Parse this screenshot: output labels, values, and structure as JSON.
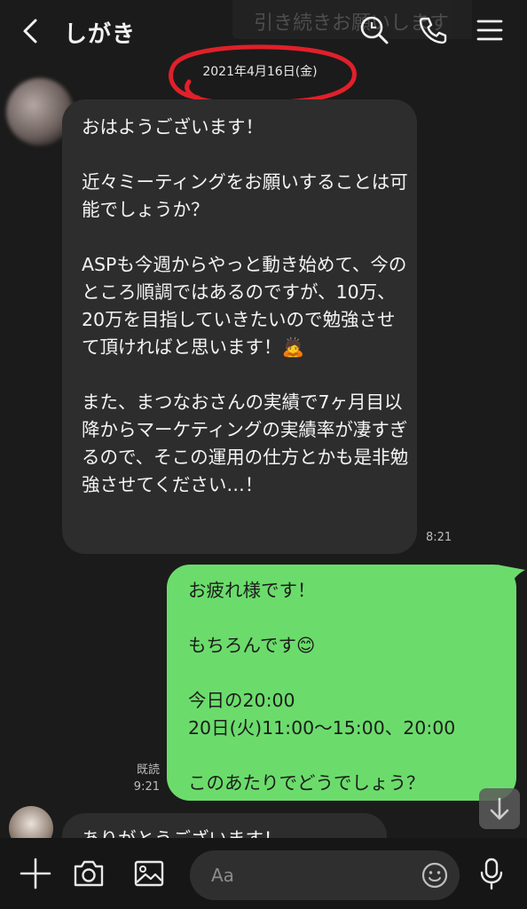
{
  "header": {
    "title": "しがき",
    "ghost_banner": "引き続きお願いします"
  },
  "date_separator": "2021年4月16日(金)",
  "messages": [
    {
      "direction": "incoming",
      "text": "おはようございます！\n\n近々ミーティングをお願いすることは可能でしょうか？\n\nASPも今週からやっと動き始めて、今のところ順調ではあるのですが、10万、20万を目指していきたいので勉強させて頂ければと思います！🙇\n\nまた、まつなおさんの実績で7ヶ月目以降からマーケティングの実績率が凄すぎるので、そこの運用の仕方とかも是非勉強させてください…！",
      "time": "8:21"
    },
    {
      "direction": "outgoing",
      "text": "お疲れ様です！\n\nもちろんです😊\n\n今日の20:00\n20日(火)11:00〜15:00、20:00\n\nこのあたりでどうでしょう？",
      "read_label": "既読",
      "time": "9:21"
    },
    {
      "direction": "incoming",
      "text": "ありがとうございます！"
    }
  ],
  "composer": {
    "placeholder": "Aa"
  },
  "colors": {
    "outgoing_bubble": "#6bdc6b",
    "incoming_bubble": "#2d2d2d",
    "background": "#1b1b1b",
    "annotation_circle": "#e0202a"
  },
  "icons": {
    "back": "chevron-left-icon",
    "search": "search-icon",
    "call": "phone-icon",
    "menu": "menu-icon",
    "add": "plus-icon",
    "camera": "camera-icon",
    "image": "image-icon",
    "emoji": "emoji-icon",
    "mic": "microphone-icon",
    "scroll": "arrow-down-icon"
  }
}
